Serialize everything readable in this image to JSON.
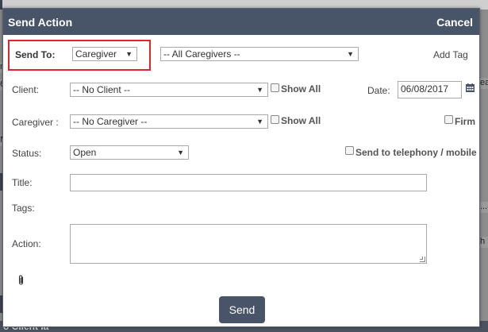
{
  "background": {
    "left_fragments": [
      "n",
      "6/",
      "N",
      "Ti",
      "A",
      "",
      "V",
      "g"
    ],
    "right_fragments": [
      "ea",
      "...",
      "h"
    ],
    "bottom_text": "o Client Ia"
  },
  "modal": {
    "title": "Send Action",
    "cancel_label": "Cancel",
    "send_to": {
      "label": "Send To:",
      "selected": "Caregiver"
    },
    "recipients_select": {
      "selected": "-- All Caregivers --"
    },
    "add_tag_label": "Add Tag",
    "client": {
      "label": "Client:",
      "selected": "-- No Client --",
      "show_all_label": "Show All"
    },
    "date": {
      "label": "Date:",
      "value": "06/08/2017"
    },
    "caregiver": {
      "label": "Caregiver :",
      "selected": "-- No Caregiver --",
      "show_all_label": "Show All",
      "firm_label": "Firm"
    },
    "status": {
      "label": "Status:",
      "selected": "Open",
      "telephony_label": "Send to telephony / mobile"
    },
    "title_field": {
      "label": "Title:",
      "value": ""
    },
    "tags_label": "Tags:",
    "action_field": {
      "label": "Action:",
      "value": ""
    },
    "send_label": "Send"
  },
  "colors": {
    "header_bg": "#485467",
    "highlight": "#e0262c",
    "button_bg": "#485467"
  }
}
